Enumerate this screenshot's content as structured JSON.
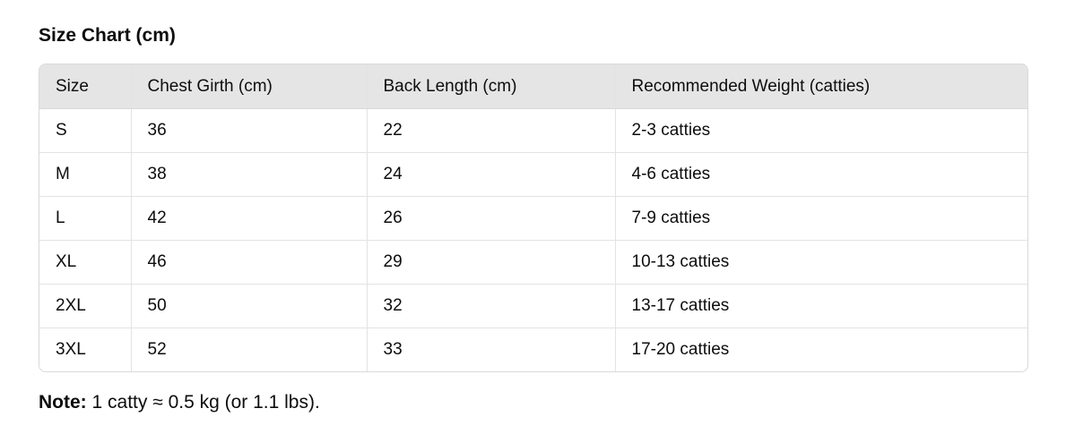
{
  "title": "Size Chart (cm)",
  "table": {
    "headers": [
      "Size",
      "Chest Girth (cm)",
      "Back Length (cm)",
      "Recommended Weight (catties)"
    ],
    "rows": [
      [
        "S",
        "36",
        "22",
        "2-3 catties"
      ],
      [
        "M",
        "38",
        "24",
        "4-6 catties"
      ],
      [
        "L",
        "42",
        "26",
        "7-9 catties"
      ],
      [
        "XL",
        "46",
        "29",
        "10-13 catties"
      ],
      [
        "2XL",
        "50",
        "32",
        "13-17 catties"
      ],
      [
        "3XL",
        "52",
        "33",
        "17-20 catties"
      ]
    ]
  },
  "note": {
    "label": "Note:",
    "text": " 1 catty ≈ 0.5 kg (or 1.1 lbs)."
  },
  "colors": {
    "header_bg": "#e5e5e5",
    "border": "#d9d9d9",
    "text": "#0d0d0d"
  }
}
